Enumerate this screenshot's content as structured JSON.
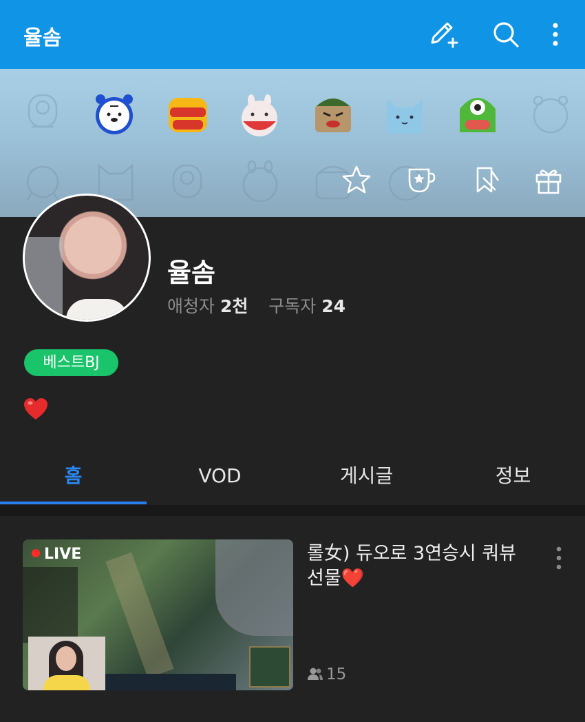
{
  "app_bar": {
    "title": "율솜",
    "actions": [
      "edit-icon",
      "search-icon",
      "more-vertical-icon"
    ],
    "background": "#0f94e6"
  },
  "banner": {
    "emoticons": [
      "robot-ghost",
      "tiger",
      "yellow-bird",
      "white-rabbit",
      "green-helmet",
      "blue-cat",
      "green-monster",
      "tiger-ghost"
    ],
    "actions": [
      "star-icon",
      "coffee-star-icon",
      "bookmark-ribbon-icon",
      "gift-icon"
    ]
  },
  "profile": {
    "name": "율솜",
    "followers_label": "애청자",
    "followers_value": "2천",
    "subscribers_label": "구독자",
    "subscribers_value": "24",
    "badge": "베스트BJ",
    "badge_color": "#19c46a",
    "bio_emoji": "heart"
  },
  "tabs": [
    {
      "label": "홈",
      "active": true
    },
    {
      "label": "VOD",
      "active": false
    },
    {
      "label": "게시글",
      "active": false
    },
    {
      "label": "정보",
      "active": false
    }
  ],
  "accent": "#2a86f0",
  "live_card": {
    "badge": "LIVE",
    "title": "롤女) 듀오로 3연승시 쿼뷰 선물❤️",
    "viewers": "15"
  }
}
